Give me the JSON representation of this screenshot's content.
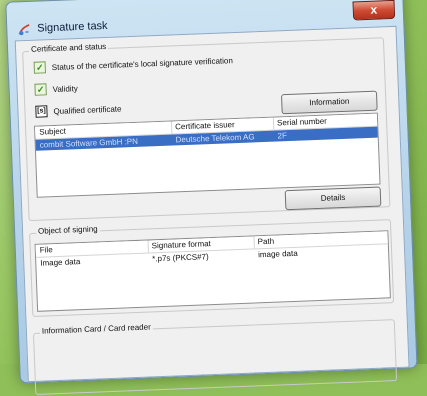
{
  "window": {
    "title": "Signature task",
    "close_label": "x"
  },
  "certificate_group": {
    "label": "Certificate and status",
    "status_local_label": "Status of the certificate's local signature verification",
    "validity_label": "Validity",
    "qualified_label": "Qualified certificate",
    "qualified_icon": "[s]",
    "information_button": "Information",
    "details_button": "Details",
    "columns": [
      "Subject",
      "Certificate issuer",
      "Serial number"
    ],
    "rows": [
      {
        "subject": "combit Software GmbH :PN",
        "issuer": "Deutsche Telekom AG",
        "serial": "2F",
        "selected": true
      }
    ]
  },
  "signing_group": {
    "label": "Object of signing",
    "columns": [
      "File",
      "Signature format",
      "Path"
    ],
    "rows": [
      {
        "file": "Image data",
        "format": "*.p7s (PKCS#7)",
        "path": "image data"
      }
    ]
  },
  "card_group": {
    "label": "Information Card / Card reader"
  }
}
